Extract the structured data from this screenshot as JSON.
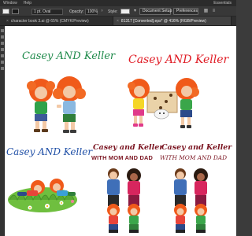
{
  "menubar": {
    "items": [
      "Window",
      "Help"
    ],
    "right_items": [
      "Essentials"
    ]
  },
  "controlbar": {
    "stroke_dd": "1 pt. Oval",
    "opacity_label": "Opacity:",
    "opacity_value": "100%",
    "style_label": "Style:",
    "document_setup": "Document Setup",
    "preferences": "Preferences"
  },
  "tabs": [
    {
      "label": "character book 3.ai @ 65% (CMYK/Preview)",
      "active": false
    },
    {
      "label": "81317 [Converted].eps* @ 416% (RGB/Preview)",
      "active": true
    }
  ],
  "artboard": {
    "title1": "Casey AND Keller",
    "title2": "Casey AND Keller",
    "title3": "Casey AND Keller",
    "title4_line1": "Casey and Keller",
    "title4_line2": "WITH MOM AND DAD",
    "title5_line1": "Casey and Keller",
    "title5_line2": "WITH MOM AND DAD"
  },
  "colors": {
    "green_title": "#1e8a4a",
    "red_title": "#e01b24",
    "blue_title": "#1f4fa6",
    "maroon_title": "#7a1420",
    "hair": "#f05a1a"
  }
}
